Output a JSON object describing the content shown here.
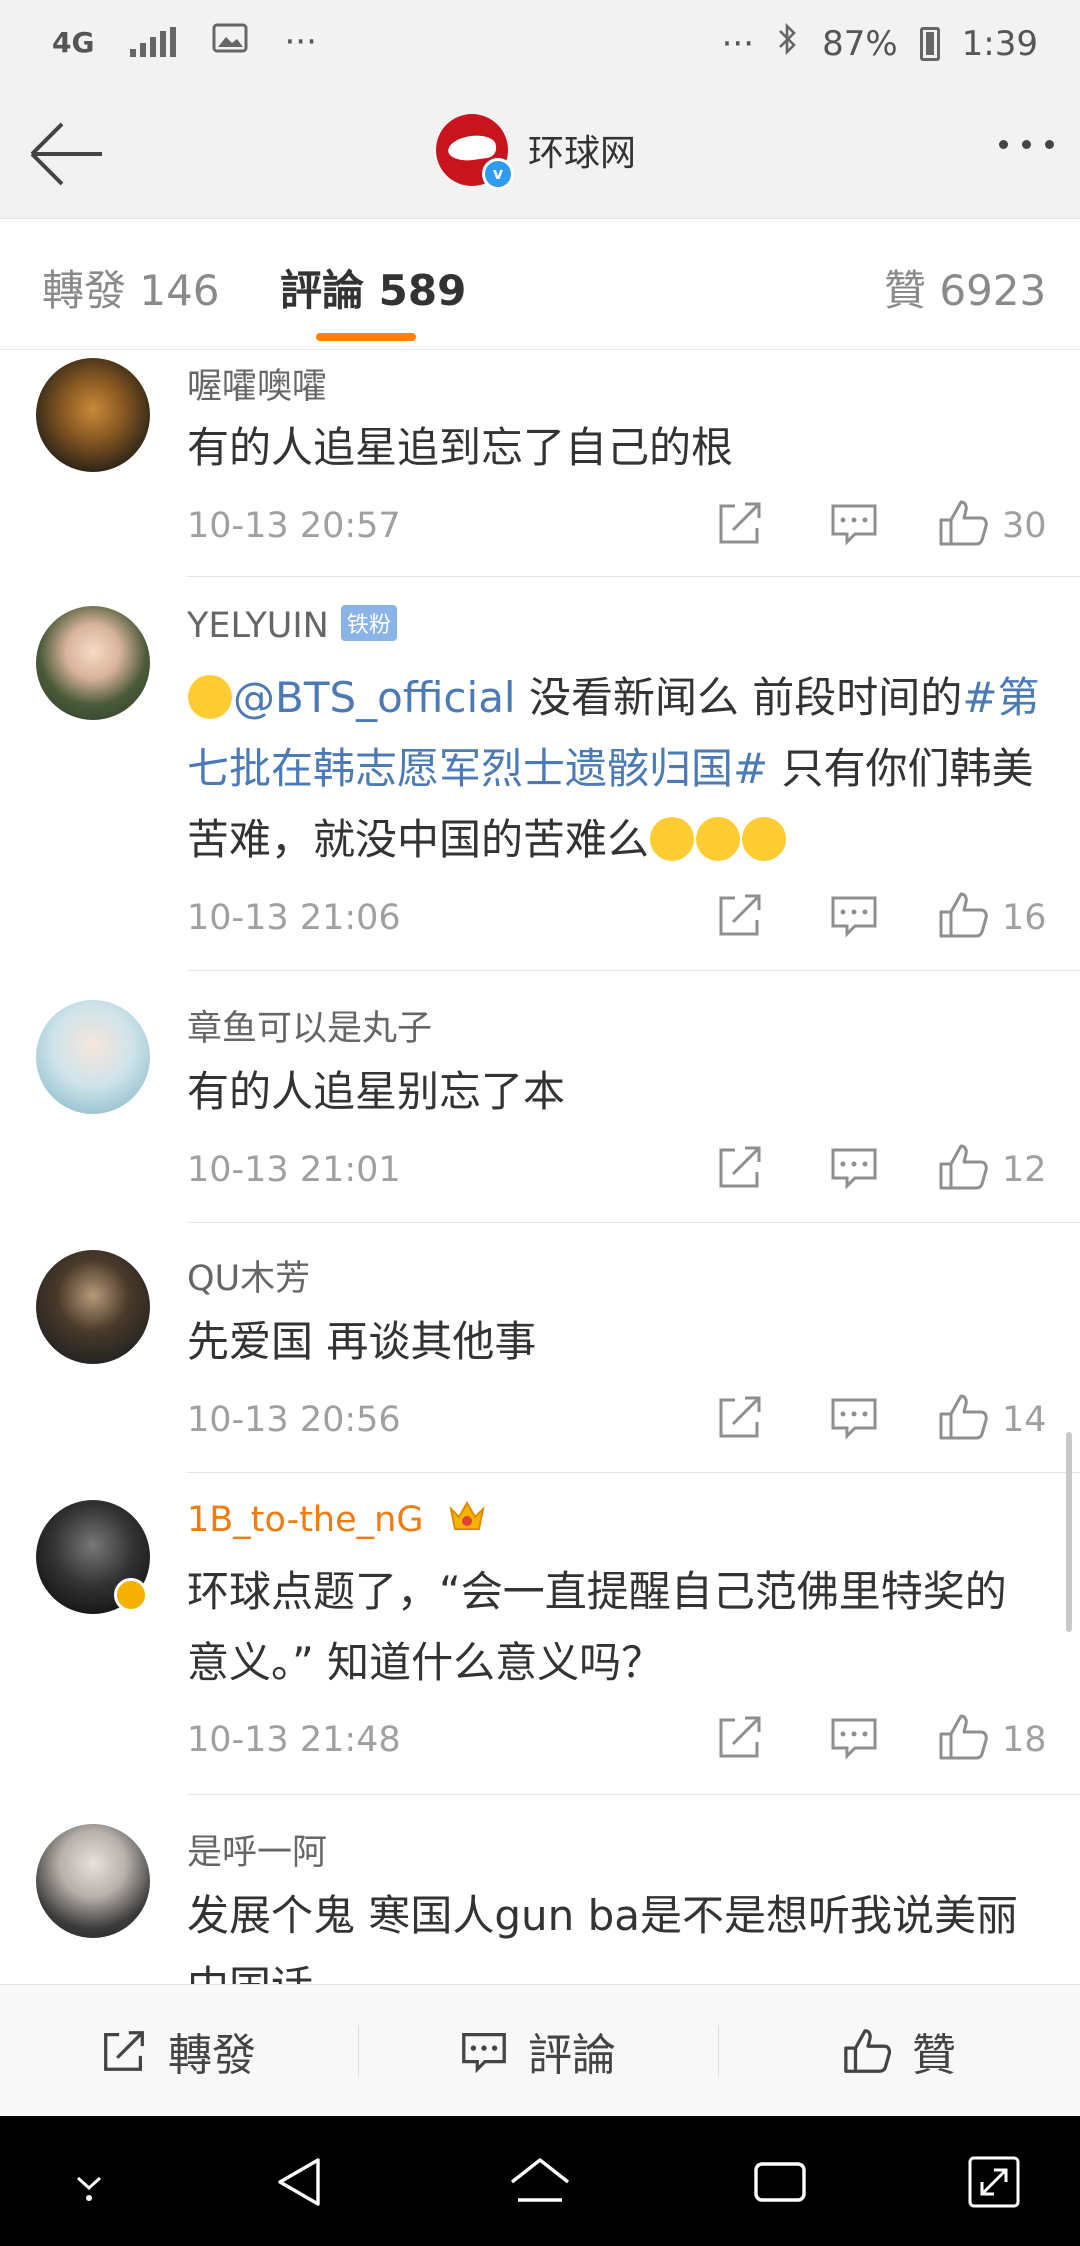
{
  "status_bar": {
    "network": "4G",
    "overflow": "···",
    "overflow_right": "···",
    "battery": "87%",
    "time": "1:39"
  },
  "nav": {
    "title": "环球网",
    "verified": "v"
  },
  "tabs": [
    {
      "label": "轉發 146"
    },
    {
      "label": "評論 589"
    },
    {
      "label": "贊 6923"
    }
  ],
  "comments": [
    {
      "name": "喔嚯噢嚯",
      "text": "有的人追星追到忘了自己的根",
      "time": "10-13 20:57",
      "likes": "30"
    },
    {
      "name": "YELYUIN",
      "badge": "铁粉",
      "mention": "@BTS_official",
      "text_a": " 没看新闻么 前段时间的",
      "hashtag": "#第七批在韩志愿军烈士遗骸归国#",
      "text_b": " 只有你们韩美苦难，就没中国的苦难么",
      "time": "10-13 21:06",
      "likes": "16"
    },
    {
      "name": "章鱼可以是丸子",
      "text": "有的人追星别忘了本",
      "time": "10-13 21:01",
      "likes": "12"
    },
    {
      "name": "QU木芳",
      "text": "先爱国  再谈其他事",
      "time": "10-13 20:56",
      "likes": "14"
    },
    {
      "name": "1B_to-the_nG",
      "text": "环球点题了，“会一直提醒自己范佛里特奖的意义。”  知道什么意义吗？",
      "time": "10-13 21:48",
      "likes": "18"
    },
    {
      "name": "是呼一阿",
      "text": "发展个鬼 寒国人gun ba是不是想听我说美丽中国话"
    }
  ],
  "bottom_bar": {
    "repost": "轉發",
    "comment": "評論",
    "like": "贊"
  },
  "colors": {
    "accent": "#ff8200",
    "link": "#4b7ab6",
    "brand": "#c8141c"
  }
}
